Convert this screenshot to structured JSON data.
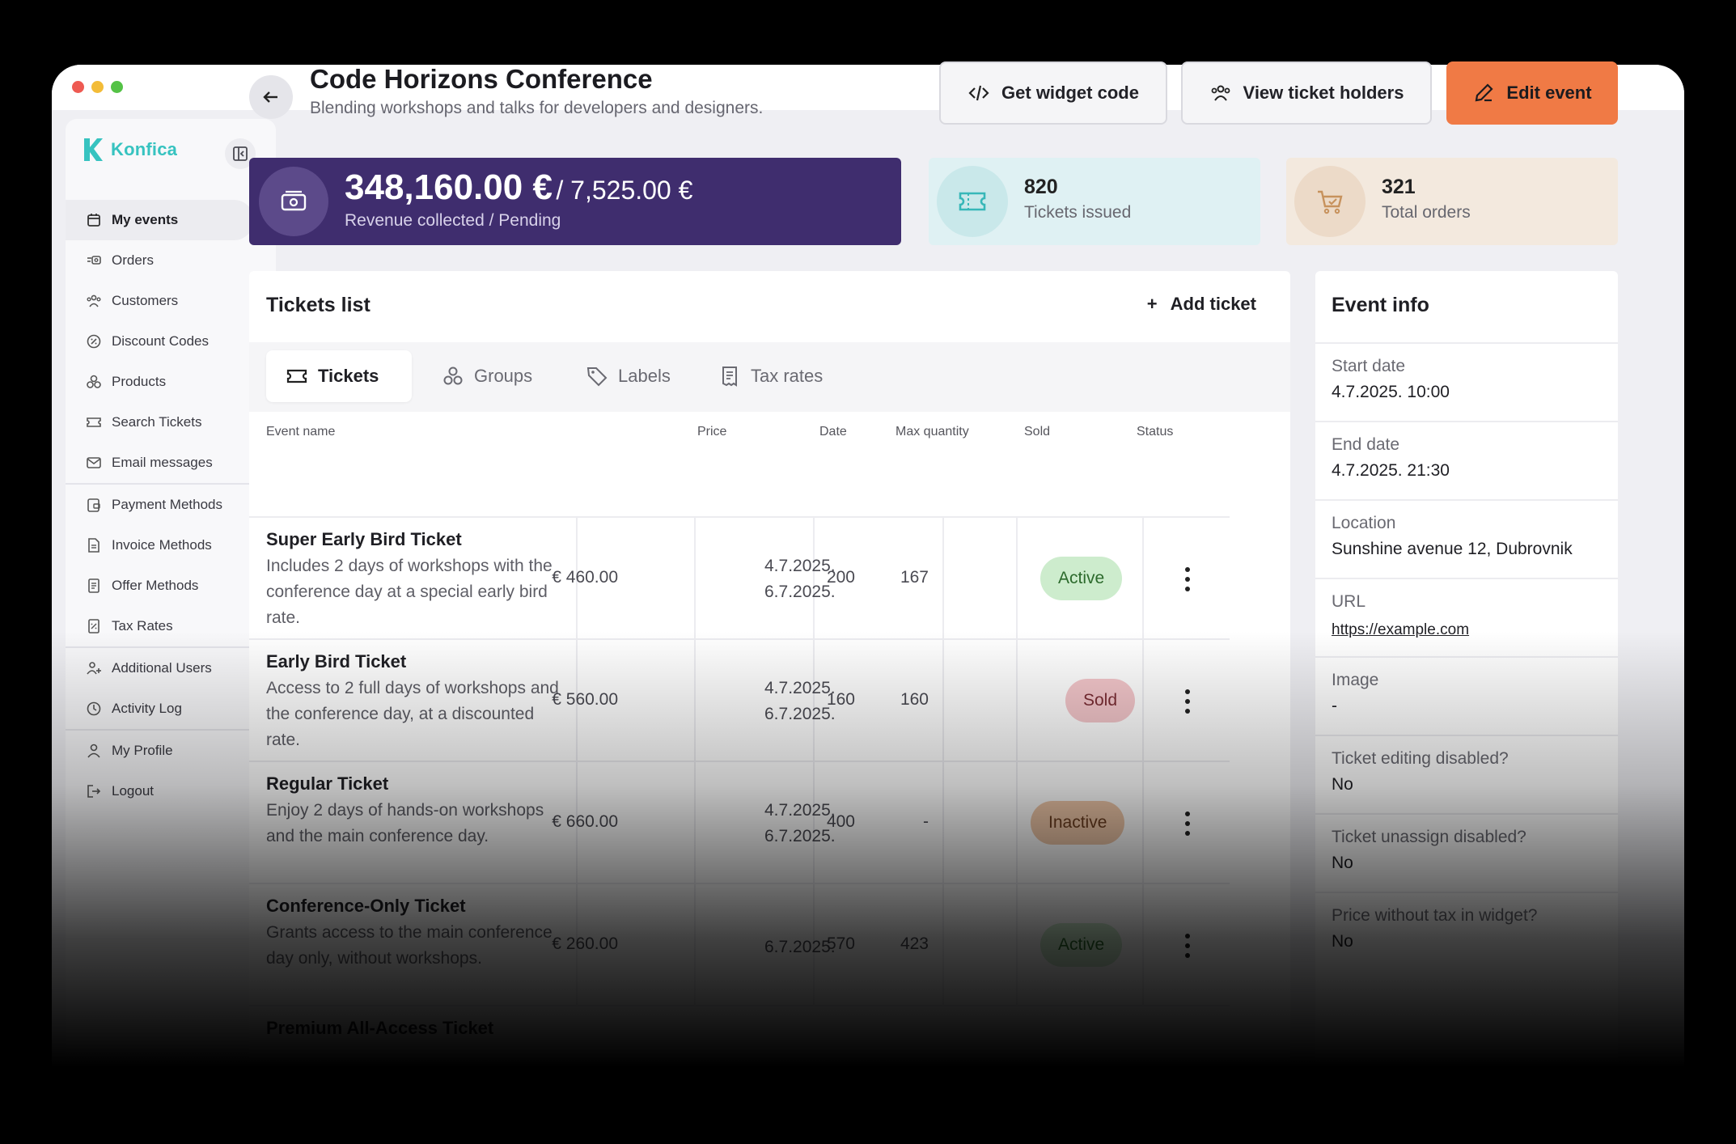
{
  "brand": {
    "name": "Konfica",
    "accent": "#37c3c0"
  },
  "sidebar": {
    "items": [
      {
        "label": "My events",
        "icon": "calendar-icon",
        "active": true
      },
      {
        "label": "Orders",
        "icon": "orders-icon"
      },
      {
        "label": "Customers",
        "icon": "users-icon"
      },
      {
        "label": "Discount Codes",
        "icon": "discount-icon"
      },
      {
        "label": "Products",
        "icon": "products-icon"
      },
      {
        "label": "Search Tickets",
        "icon": "ticket-icon"
      },
      {
        "label": "Email messages",
        "icon": "mail-icon"
      },
      {
        "label": "Payment Methods",
        "icon": "wallet-icon"
      },
      {
        "label": "Invoice Methods",
        "icon": "invoice-icon"
      },
      {
        "label": "Offer Methods",
        "icon": "document-icon"
      },
      {
        "label": "Tax Rates",
        "icon": "tax-icon"
      },
      {
        "label": "Additional Users",
        "icon": "user-plus-icon"
      },
      {
        "label": "Activity Log",
        "icon": "history-icon"
      },
      {
        "label": "My Profile",
        "icon": "user-icon"
      },
      {
        "label": "Logout",
        "icon": "logout-icon"
      }
    ]
  },
  "header": {
    "title": "Code Horizons Conference",
    "subtitle": "Blending workshops and talks for developers and designers.",
    "widget_btn": "Get widget code",
    "holders_btn": "View ticket holders",
    "edit_btn": "Edit event",
    "edit_color": "#f07a45"
  },
  "stats": {
    "revenue": "348,160.00 €",
    "pending": "/ 7,525.00 €",
    "revenue_label": "Revenue collected / Pending",
    "tickets": "820",
    "tickets_label": "Tickets issued",
    "orders": "321",
    "orders_label": "Total orders"
  },
  "tickets": {
    "title": "Tickets list",
    "add_label": "Add ticket",
    "tabs": [
      "Tickets",
      "Groups",
      "Labels",
      "Tax rates"
    ],
    "columns": [
      "Event name",
      "Price",
      "Date",
      "Max quantity",
      "Sold",
      "Status"
    ],
    "rows": [
      {
        "name": "Super Early Bird Ticket",
        "desc": "Includes 2 days of workshops with the conference day at a special early bird rate.",
        "price": "€ 460.00",
        "date1": "4.7.2025.",
        "date2": "6.7.2025.",
        "max": "200",
        "sold": "167",
        "status": "Active"
      },
      {
        "name": "Early Bird Ticket",
        "desc": "Access to 2 full days of workshops and the conference day, at a discounted rate.",
        "price": "€ 560.00",
        "date1": "4.7.2025.",
        "date2": "6.7.2025.",
        "max": "160",
        "sold": "160",
        "status": "Sold"
      },
      {
        "name": "Regular Ticket",
        "desc": "Enjoy 2 days of hands-on workshops and the main conference day.",
        "price": "€ 660.00",
        "date1": "4.7.2025.",
        "date2": "6.7.2025.",
        "max": "400",
        "sold": "-",
        "status": "Inactive"
      },
      {
        "name": "Conference-Only Ticket",
        "desc": "Grants access to the main conference day only, without workshops.",
        "price": "€ 260.00",
        "date1": "6.7.2025.",
        "date2": "",
        "max": "570",
        "sold": "423",
        "status": "Active"
      },
      {
        "name": "Premium All-Access Ticket",
        "desc": "",
        "price": "",
        "date1": "",
        "date2": "",
        "max": "",
        "sold": "",
        "status": ""
      }
    ]
  },
  "info": {
    "title": "Event info",
    "rows": [
      {
        "label": "Start date",
        "value": "4.7.2025. 10:00"
      },
      {
        "label": "End date",
        "value": "4.7.2025. 21:30"
      },
      {
        "label": "Location",
        "value": "Sunshine avenue 12, Dubrovnik"
      },
      {
        "label": "URL",
        "value": "https://example.com"
      },
      {
        "label": "Image",
        "value": "-"
      },
      {
        "label": "Ticket editing disabled?",
        "value": "No"
      },
      {
        "label": "Ticket unassign disabled?",
        "value": "No"
      },
      {
        "label": "Price without tax in widget?",
        "value": "No"
      }
    ]
  }
}
